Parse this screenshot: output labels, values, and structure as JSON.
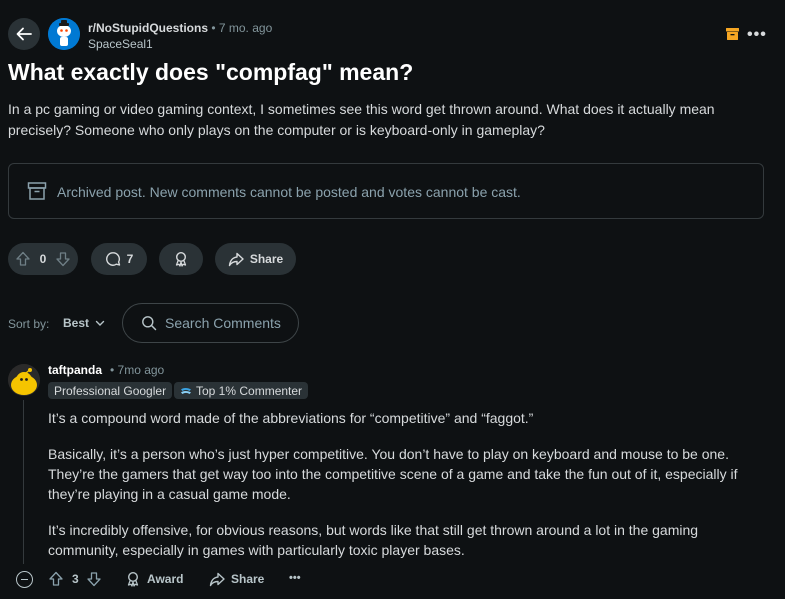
{
  "header": {
    "subreddit": "r/NoStupidQuestions",
    "post_age": "• 7 mo. ago",
    "author": "SpaceSeal1",
    "icons": [
      "back-arrow-icon",
      "archive-icon",
      "more-options-icon"
    ]
  },
  "post": {
    "title": "What exactly does \"compfag\" mean?",
    "body": "In a pc gaming or video gaming context, I sometimes see this word get thrown around. What does it actually mean precisely? Someone who only plays on the computer or is keyboard-only in gameplay?",
    "archived_notice": "Archived post. New comments cannot be posted and votes cannot be cast.",
    "votes": "0",
    "comments": "7",
    "share_label": "Share"
  },
  "sort": {
    "label": "Sort by:",
    "value": "Best"
  },
  "search": {
    "placeholder": "Search Comments"
  },
  "comment": {
    "user": "taftpanda",
    "time": "• 7mo ago",
    "flair": "Professional Googler",
    "badge": "Top 1% Commenter",
    "paragraphs": [
      "It’s a compound word made of the abbreviations for “competitive” and “faggot.”",
      "Basically, it’s a person who’s just hyper competitive. You don’t have to play on keyboard and mouse to be one. They’re the gamers that get way too into the competitive scene of a game and take the fun out of it, especially if they’re playing in a casual game mode.",
      "It’s incredibly offensive, for obvious reasons, but words like that still get thrown around a lot in the gaming community, especially in games with particularly toxic player bases."
    ],
    "votes": "3",
    "award_label": "Award",
    "share_label": "Share",
    "more_label": "•••"
  },
  "colors": {
    "background": "#0e1113",
    "pill": "#2a3236",
    "archive_accent": "#f5a623",
    "avatar_blue": "#0079d3",
    "avatar_yellow": "#f5c400"
  }
}
